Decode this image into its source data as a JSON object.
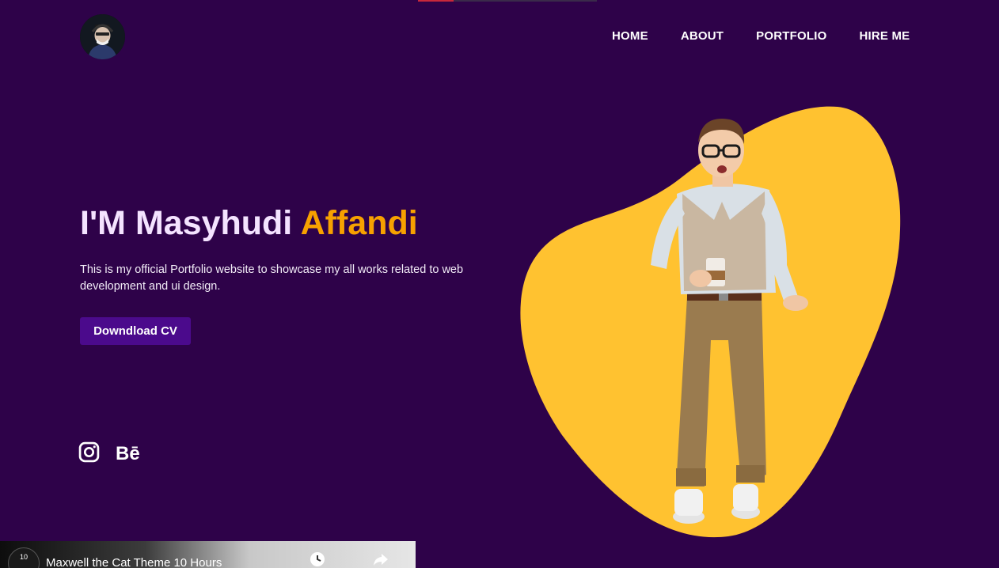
{
  "nav": {
    "items": [
      {
        "label": "HOME"
      },
      {
        "label": "ABOUT"
      },
      {
        "label": "PORTFOLIO"
      },
      {
        "label": "HIRE ME"
      }
    ]
  },
  "hero": {
    "title_prefix": "I'M Masyhudi ",
    "title_accent": "Affandi",
    "description": "This is my official Portfolio website to showcase my all works related to web development and ui design.",
    "cta_label": "Downdload CV"
  },
  "social": {
    "icons": [
      "instagram-icon",
      "behance-icon"
    ],
    "behance_text": "Bē"
  },
  "video": {
    "channel_badge": "10",
    "title": "Maxwell the Cat Theme 10 Hours"
  },
  "colors": {
    "background": "#2e0249",
    "accent": "#f7a100",
    "blob": "#ffc230",
    "button": "#4b0a8c"
  }
}
